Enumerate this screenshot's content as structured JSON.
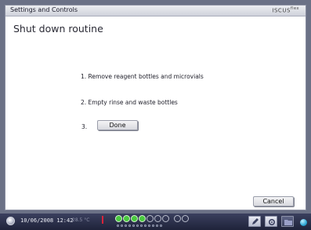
{
  "window": {
    "title": "Settings and Controls",
    "brand": "ISCUS",
    "brand_sup": "flex",
    "brand_suffix": "| flex"
  },
  "main": {
    "heading": "Shut down routine",
    "steps": [
      "1. Remove reagent bottles and microvials",
      "2. Empty rinse and waste bottles",
      "3."
    ],
    "done_label": "Done",
    "cancel_label": "Cancel"
  },
  "taskbar": {
    "datetime": "10/06/2008 12:42",
    "temperature": "28.5 °C",
    "slot_states": [
      "green",
      "green",
      "green",
      "green",
      "empty",
      "empty",
      "empty",
      "empty",
      "empty"
    ],
    "icons": [
      "power-icon",
      "edit-icon",
      "gear-icon",
      "folder-icon",
      "network-icon"
    ],
    "colors": {
      "accent_green": "#48c93e",
      "alarm_red": "#d9243a",
      "taskbar": "#2a2f44"
    }
  }
}
